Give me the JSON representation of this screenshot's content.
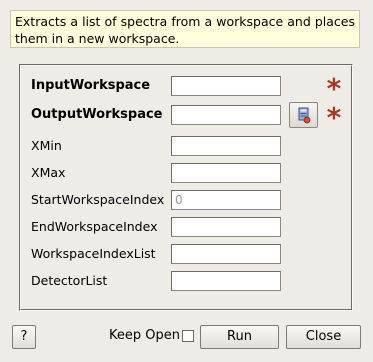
{
  "description": "Extracts a list of spectra from a workspace and places them in a new workspace.",
  "fields": [
    {
      "label": "InputWorkspace",
      "value": "",
      "required": true,
      "bold": true
    },
    {
      "label": "OutputWorkspace",
      "value": "",
      "required": true,
      "bold": true
    },
    {
      "label": "XMin",
      "value": ""
    },
    {
      "label": "XMax",
      "value": ""
    },
    {
      "label": "StartWorkspaceIndex",
      "value": "0",
      "disabled": true
    },
    {
      "label": "EndWorkspaceIndex",
      "value": ""
    },
    {
      "label": "WorkspaceIndexList",
      "value": ""
    },
    {
      "label": "DetectorList",
      "value": ""
    }
  ],
  "required_marker": "*",
  "icons": {
    "browse": "workspace-browse-icon"
  },
  "footer": {
    "help_label": "?",
    "keep_open_label": "Keep Open",
    "keep_open_checked": false,
    "run_label": "Run",
    "close_label": "Close"
  },
  "colors": {
    "required_star": "#a33a25",
    "description_bg": "#ffffdc"
  }
}
